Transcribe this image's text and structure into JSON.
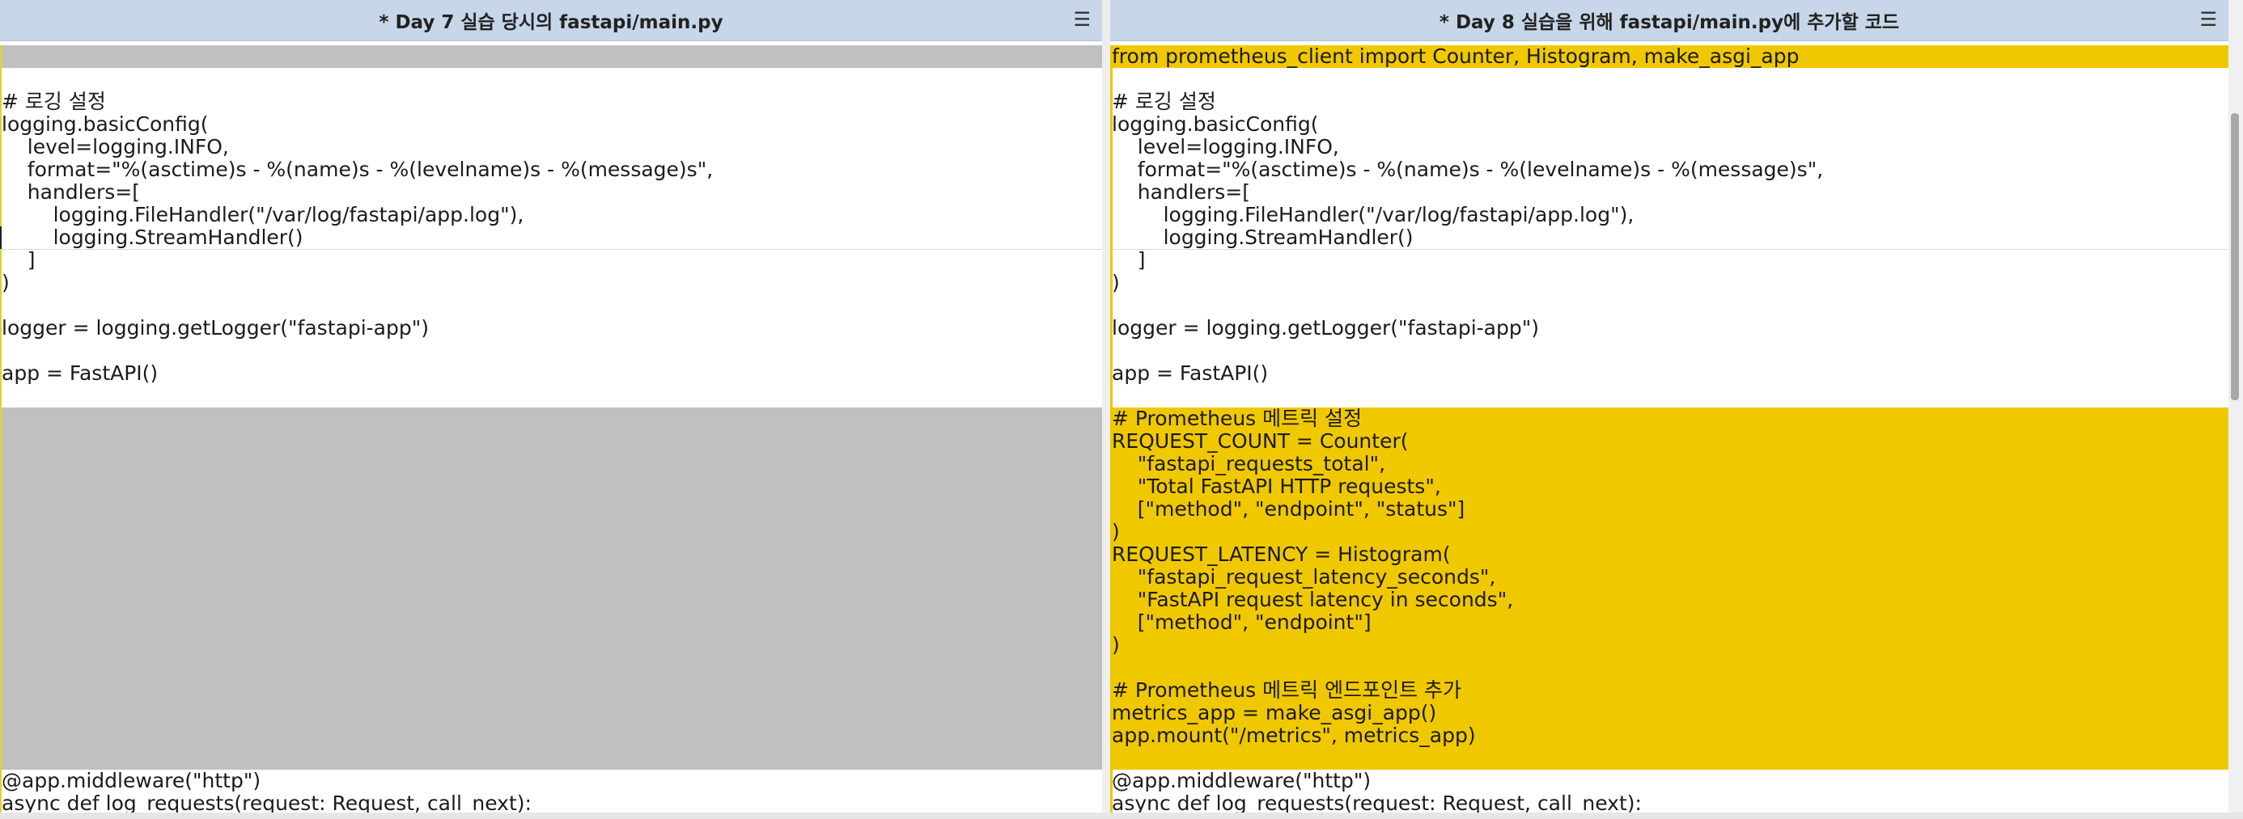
{
  "left_pane": {
    "title": "* Day 7 실습 당시의 fastapi/main.py",
    "menu_icon": "menu-icon",
    "lines": [
      "",
      "",
      "# 로깅 설정",
      "logging.basicConfig(",
      "    level=logging.INFO,",
      "    format=\"%(asctime)s - %(name)s - %(levelname)s - %(message)s\",",
      "    handlers=[",
      "        logging.FileHandler(\"/var/log/fastapi/app.log\"),",
      "        logging.StreamHandler()",
      "    ]",
      ")",
      "",
      "logger = logging.getLogger(\"fastapi-app\")",
      "",
      "app = FastAPI()",
      "",
      "",
      "",
      "",
      "",
      "",
      "",
      "",
      "",
      "",
      "",
      "",
      "",
      "",
      "",
      "",
      "",
      "@app.middleware(\"http\")",
      "async def log_requests(request: Request, call_next):"
    ]
  },
  "right_pane": {
    "title": "* Day 8 실습을 위해 fastapi/main.py에 추가할 코드",
    "menu_icon": "menu-icon",
    "lines": [
      "from prometheus_client import Counter, Histogram, make_asgi_app",
      "",
      "# 로깅 설정",
      "logging.basicConfig(",
      "    level=logging.INFO,",
      "    format=\"%(asctime)s - %(name)s - %(levelname)s - %(message)s\",",
      "    handlers=[",
      "        logging.FileHandler(\"/var/log/fastapi/app.log\"),",
      "        logging.StreamHandler()",
      "    ]",
      ")",
      "",
      "logger = logging.getLogger(\"fastapi-app\")",
      "",
      "app = FastAPI()",
      "",
      "# Prometheus 메트릭 설정",
      "REQUEST_COUNT = Counter(",
      "    \"fastapi_requests_total\",",
      "    \"Total FastAPI HTTP requests\",",
      "    [\"method\", \"endpoint\", \"status\"]",
      ")",
      "REQUEST_LATENCY = Histogram(",
      "    \"fastapi_request_latency_seconds\",",
      "    \"FastAPI request latency in seconds\",",
      "    [\"method\", \"endpoint\"]",
      ")",
      "",
      "# Prometheus 메트릭 엔드포인트 추가",
      "metrics_app = make_asgi_app()",
      "app.mount(\"/metrics\", metrics_app)",
      "",
      "@app.middleware(\"http\")",
      "async def log_requests(request: Request, call_next):"
    ]
  },
  "colors": {
    "diff_added": "#f0c800",
    "diff_placeholder": "#c0c0c0",
    "titlebar": "#c7d6e8"
  }
}
